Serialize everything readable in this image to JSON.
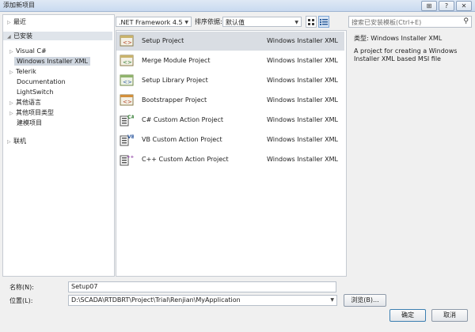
{
  "window": {
    "title": "添加新项目",
    "controls": {
      "collapse": "⊞",
      "help": "?",
      "close": "✕"
    }
  },
  "nav": [
    {
      "label": "最近",
      "arrow": "▷",
      "indent": 0
    },
    {
      "label": "已安装",
      "arrow": "◢",
      "indent": 0,
      "selected": true
    },
    {
      "label": "Visual C#",
      "arrow": "▷",
      "indent": 1
    },
    {
      "label": "Windows Installer XML",
      "arrow": "",
      "indent": 1,
      "leaf_selected": true
    },
    {
      "label": "Telerik",
      "arrow": "▷",
      "indent": 1
    },
    {
      "label": "Documentation",
      "arrow": "",
      "indent": 1
    },
    {
      "label": "LightSwitch",
      "arrow": "",
      "indent": 1
    },
    {
      "label": "其他语言",
      "arrow": "▷",
      "indent": 1
    },
    {
      "label": "其他项目类型",
      "arrow": "▷",
      "indent": 1
    },
    {
      "label": "建模项目",
      "arrow": "",
      "indent": 1
    },
    {
      "label": "联机",
      "arrow": "▷",
      "indent": 0
    }
  ],
  "toolbar": {
    "framework": ".NET Framework 4.5",
    "sort_label": "排序依据:",
    "sort_value": "默认值"
  },
  "templates": [
    {
      "name": "Setup Project",
      "type": "Windows Installer XML",
      "selected": true,
      "icon": "setup-project-icon"
    },
    {
      "name": "Merge Module Project",
      "type": "Windows Installer XML",
      "icon": "merge-module-icon"
    },
    {
      "name": "Setup Library Project",
      "type": "Windows Installer XML",
      "icon": "setup-library-icon"
    },
    {
      "name": "Bootstrapper Project",
      "type": "Windows Installer XML",
      "icon": "bootstrapper-icon"
    },
    {
      "name": "C# Custom Action Project",
      "type": "Windows Installer XML",
      "icon": "csharp-action-icon"
    },
    {
      "name": "VB Custom Action Project",
      "type": "Windows Installer XML",
      "icon": "vb-action-icon"
    },
    {
      "name": "C++ Custom Action Project",
      "type": "Windows Installer XML",
      "icon": "cpp-action-icon"
    }
  ],
  "search": {
    "placeholder": "搜索已安装模板(Ctrl+E)"
  },
  "description": {
    "type_label": "类型:",
    "type_value": "Windows Installer XML",
    "text": "A project for creating a Windows Installer XML based MSI file"
  },
  "form": {
    "name_label": "名称(N):",
    "name_value": "Setup07",
    "location_label": "位置(L):",
    "location_value": "D:\\SCADA\\RTDBRT\\Project\\Trial\\Renjian\\MyApplication",
    "browse": "浏览(B)...",
    "ok": "确定",
    "cancel": "取消"
  },
  "colors": {
    "selected_row": "#d9dde3",
    "titlebar": "#c9daf0",
    "background": "#f0f0f0"
  }
}
